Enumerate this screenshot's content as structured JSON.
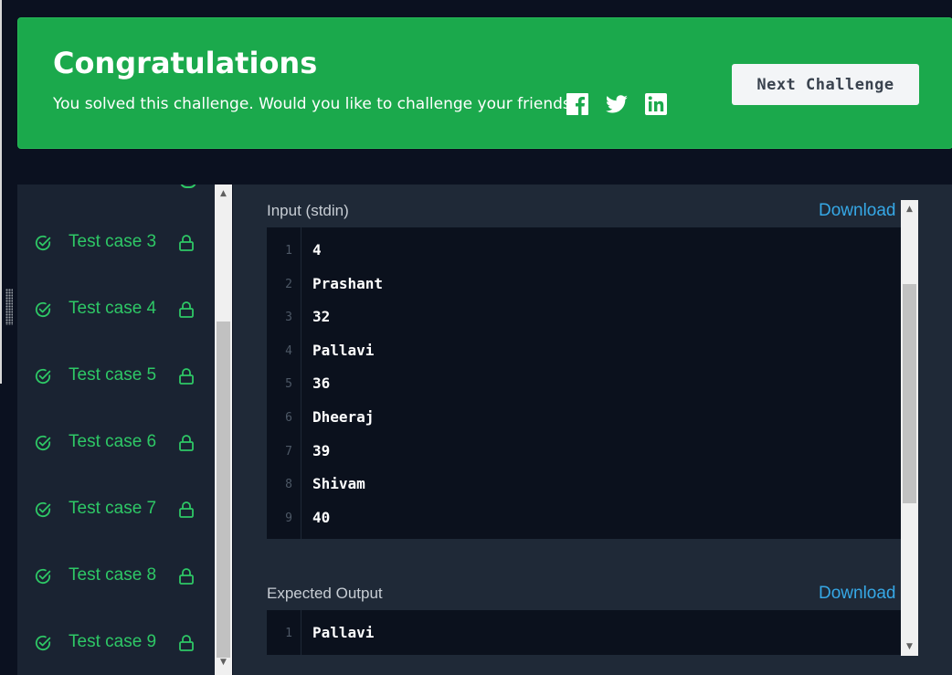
{
  "banner": {
    "title": "Congratulations",
    "subtitle": "You solved this challenge. Would you like to challenge your friends?",
    "next_button": "Next Challenge",
    "social_icons": [
      "facebook-icon",
      "twitter-icon",
      "linkedin-icon"
    ]
  },
  "sidebar": {
    "test_cases": [
      {
        "label": "Test case 3",
        "status": "passed",
        "locked": true
      },
      {
        "label": "Test case 4",
        "status": "passed",
        "locked": true
      },
      {
        "label": "Test case 5",
        "status": "passed",
        "locked": true
      },
      {
        "label": "Test case 6",
        "status": "passed",
        "locked": true
      },
      {
        "label": "Test case 7",
        "status": "passed",
        "locked": true
      },
      {
        "label": "Test case 8",
        "status": "passed",
        "locked": true
      },
      {
        "label": "Test case 9",
        "status": "passed",
        "locked": true
      }
    ]
  },
  "input": {
    "label": "Input (stdin)",
    "download": "Download",
    "lines": [
      {
        "n": "1",
        "text": "4"
      },
      {
        "n": "2",
        "text": "Prashant"
      },
      {
        "n": "3",
        "text": "32"
      },
      {
        "n": "4",
        "text": "Pallavi"
      },
      {
        "n": "5",
        "text": "36"
      },
      {
        "n": "6",
        "text": "Dheeraj"
      },
      {
        "n": "7",
        "text": "39"
      },
      {
        "n": "8",
        "text": "Shivam"
      },
      {
        "n": "9",
        "text": "40"
      }
    ]
  },
  "expected": {
    "label": "Expected Output",
    "download": "Download",
    "lines": [
      {
        "n": "1",
        "text": "Pallavi"
      }
    ]
  },
  "colors": {
    "banner_bg": "#1ba94c",
    "success_green": "#2ec866",
    "link_blue": "#36a8e6",
    "page_bg": "#0b1120"
  }
}
